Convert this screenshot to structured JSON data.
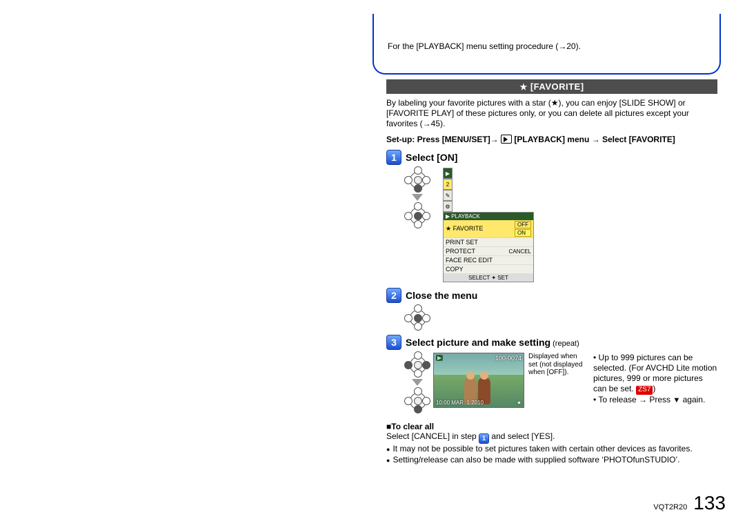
{
  "topnote": "For the [PLAYBACK] menu setting procedure (→20).",
  "section": {
    "star": "★",
    "title": "[FAVORITE]"
  },
  "intro": {
    "line1_a": "By labeling your favorite pictures with a star (",
    "line1_star": "★",
    "line1_b": "), you can enjoy [SLIDE SHOW] or [FAVORITE PLAY] of these pictures only, or you can delete all pictures except your favorites (→45)."
  },
  "setup": {
    "prefix": "Set-up: Press [MENU/SET]→ ",
    "menu": "[PLAYBACK] menu → Select [FAVORITE]"
  },
  "steps": {
    "s1": {
      "num": "1",
      "title": "Select [ON]"
    },
    "s2": {
      "num": "2",
      "title": "Close the menu"
    },
    "s3": {
      "num": "3",
      "title": "Select picture and make setting",
      "sub": " (repeat)"
    }
  },
  "screen1": {
    "titlebar_icon": "▶",
    "titlebar": "PLAYBACK",
    "r1": "★ FAVORITE",
    "r1_opt_off": "OFF",
    "r1_opt_on": "ON",
    "r2": "PRINT SET",
    "r2_right": "",
    "r3": "PROTECT",
    "r3_right": "CANCEL",
    "r4": "FACE REC EDIT",
    "r5": "COPY",
    "footer": "SELECT ✦  SET"
  },
  "photo": {
    "tl": "▶",
    "tr": "100-0074",
    "bl_date": "10:00  MAR. 1.2010",
    "bl_star": "★"
  },
  "photo_caption": "Displayed when set (not displayed when [OFF]).",
  "right_notes": {
    "n1": "Up to 999 pictures can be selected. (For AVCHD Lite motion pictures, 999 or more pictures can be set.",
    "model": "ZS7",
    "n1_close": ")",
    "n2_a": "To release → Press ",
    "n2_tri": "▼",
    "n2_b": " again."
  },
  "to_clear": {
    "title": "■To clear all",
    "line_a": "Select [CANCEL] in step ",
    "step_ref": "1",
    "line_b": " and select [YES].",
    "b1": "It may not be possible to set pictures taken with certain other devices as favorites.",
    "b2": "Setting/release can also be made with supplied software ‘PHOTOfunSTUDIO’."
  },
  "footer": {
    "code": "VQT2R20",
    "page": "133"
  }
}
